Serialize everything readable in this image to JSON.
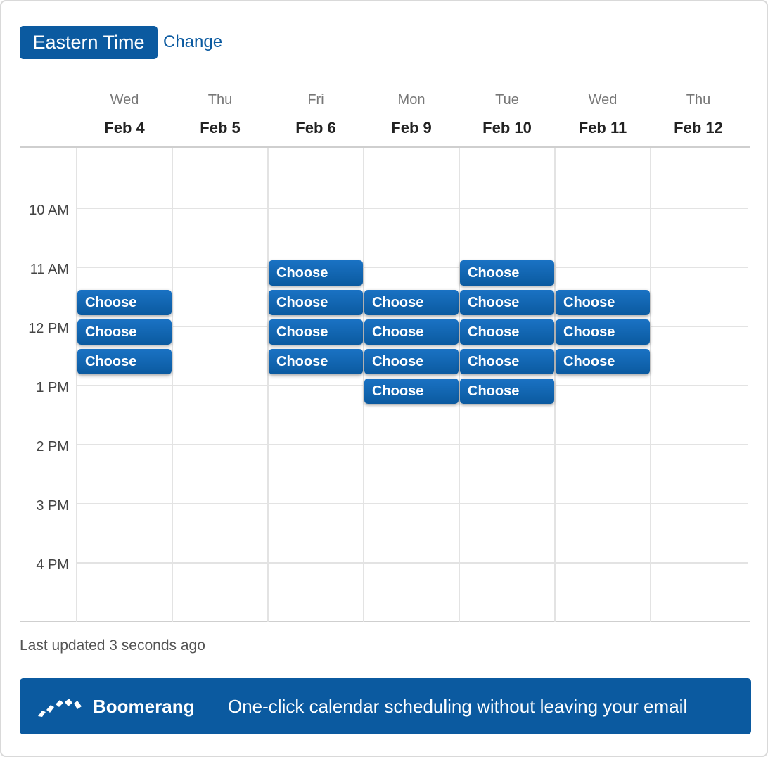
{
  "timezone": {
    "label": "Eastern Time",
    "change_label": "Change"
  },
  "days": [
    {
      "name": "Wed",
      "date": "Feb 4"
    },
    {
      "name": "Thu",
      "date": "Feb 5"
    },
    {
      "name": "Fri",
      "date": "Feb 6"
    },
    {
      "name": "Mon",
      "date": "Feb 9"
    },
    {
      "name": "Tue",
      "date": "Feb 10"
    },
    {
      "name": "Wed",
      "date": "Feb 11"
    },
    {
      "name": "Thu",
      "date": "Feb 12"
    }
  ],
  "times": [
    "10 AM",
    "11 AM",
    "12 PM",
    "1 PM",
    "2 PM",
    "3 PM",
    "4 PM"
  ],
  "slot_label": "Choose",
  "slots": [
    {
      "day": "Feb 4",
      "start": "11:30 AM"
    },
    {
      "day": "Feb 4",
      "start": "12:00 PM"
    },
    {
      "day": "Feb 4",
      "start": "12:30 PM"
    },
    {
      "day": "Feb 6",
      "start": "11:00 AM"
    },
    {
      "day": "Feb 6",
      "start": "11:30 AM"
    },
    {
      "day": "Feb 6",
      "start": "12:00 PM"
    },
    {
      "day": "Feb 6",
      "start": "12:30 PM"
    },
    {
      "day": "Feb 9",
      "start": "11:30 AM"
    },
    {
      "day": "Feb 9",
      "start": "12:00 PM"
    },
    {
      "day": "Feb 9",
      "start": "12:30 PM"
    },
    {
      "day": "Feb 9",
      "start": "1:00 PM"
    },
    {
      "day": "Feb 10",
      "start": "11:00 AM"
    },
    {
      "day": "Feb 10",
      "start": "11:30 AM"
    },
    {
      "day": "Feb 10",
      "start": "12:00 PM"
    },
    {
      "day": "Feb 10",
      "start": "12:30 PM"
    },
    {
      "day": "Feb 10",
      "start": "1:00 PM"
    },
    {
      "day": "Feb 11",
      "start": "11:30 AM"
    },
    {
      "day": "Feb 11",
      "start": "12:00 PM"
    },
    {
      "day": "Feb 11",
      "start": "12:30 PM"
    }
  ],
  "status": {
    "last_updated": "Last updated 3 seconds ago"
  },
  "banner": {
    "brand": "Boomerang",
    "tagline": "One-click calendar scheduling without leaving your email",
    "logo_icon": "boomerang-logo-icon"
  },
  "colors": {
    "accent": "#0b5aa0",
    "slot_top": "#1a72c4",
    "grid": "#e3e3e3"
  }
}
